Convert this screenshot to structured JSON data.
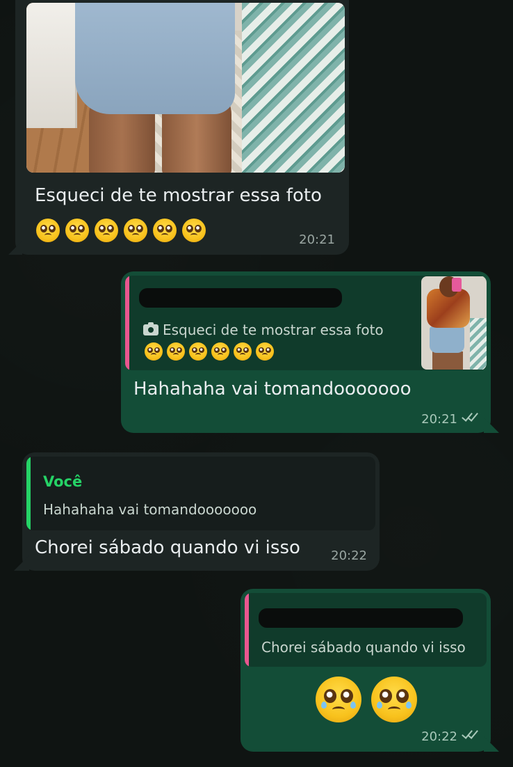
{
  "messages": [
    {
      "direction": "incoming",
      "has_photo": true,
      "photo_description_icon": "photo-image",
      "text": "Esqueci de te mostrar essa foto",
      "emoji": [
        "🥺",
        "🥺",
        "🥺",
        "🥺",
        "🥺",
        "🥺"
      ],
      "time": "20:21"
    },
    {
      "direction": "outgoing",
      "quote": {
        "author_redacted": true,
        "text": "Esqueci de te mostrar essa foto",
        "emoji": [
          "🥺",
          "🥺",
          "🥺",
          "🥺",
          "🥺",
          "🥺"
        ],
        "icon": "camera-icon",
        "has_thumbnail": true,
        "bar_color": "#e8578f"
      },
      "text": "Hahahaha vai tomandooooooo",
      "time": "20:21",
      "status": "read"
    },
    {
      "direction": "incoming",
      "quote": {
        "author": "Você",
        "text": "Hahahaha vai tomandooooooo",
        "bar_color": "#25d366"
      },
      "text": "Chorei sábado quando vi isso",
      "time": "20:22"
    },
    {
      "direction": "outgoing",
      "quote": {
        "author_redacted": true,
        "text": "Chorei sábado quando vi isso",
        "bar_color": "#e8578f"
      },
      "emoji": [
        "🥺",
        "🥺"
      ],
      "time": "20:22",
      "status": "read"
    }
  ],
  "colors": {
    "background": "#0f1412",
    "incoming_bubble": "#1d2524",
    "outgoing_bubble": "#134d37",
    "accent_green": "#25d366"
  }
}
